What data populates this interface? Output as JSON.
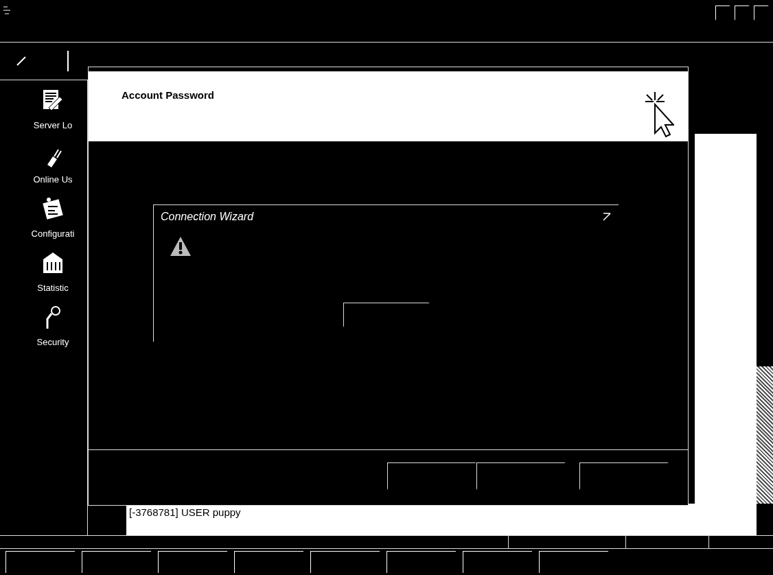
{
  "sidebar": {
    "items": [
      {
        "kind": "notepad",
        "label": "Server Lo"
      },
      {
        "kind": "plug",
        "label": "Online Us"
      },
      {
        "kind": "config",
        "label": "Configurati"
      },
      {
        "kind": "stats",
        "label": "Statistic"
      },
      {
        "kind": "key",
        "label": "Security"
      }
    ]
  },
  "dialog": {
    "title": "Account Password",
    "message_box": {
      "title": "Connection Wizard"
    }
  },
  "log": {
    "lines": [
      "[-3768781] USER puppy"
    ]
  }
}
